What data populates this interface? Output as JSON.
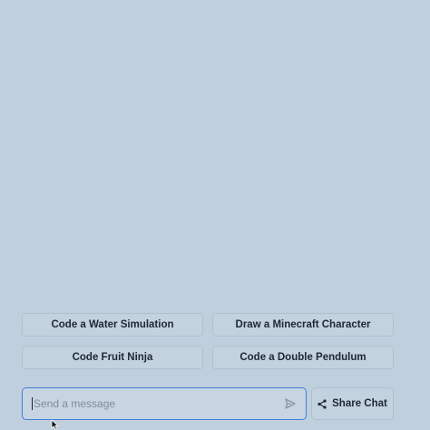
{
  "suggestions": [
    {
      "label": "Code a Water Simulation"
    },
    {
      "label": "Draw a Minecraft Character"
    },
    {
      "label": "Code Fruit Ninja"
    },
    {
      "label": "Code a Double Pendulum"
    }
  ],
  "composer": {
    "placeholder": "Send a message",
    "value": ""
  },
  "share": {
    "label": "Share Chat"
  },
  "icons": {
    "send": "send-icon",
    "share": "share-icon"
  },
  "colors": {
    "background": "#c0cfdd",
    "focus_border": "#3f7fd9",
    "text": "#1f2733"
  }
}
